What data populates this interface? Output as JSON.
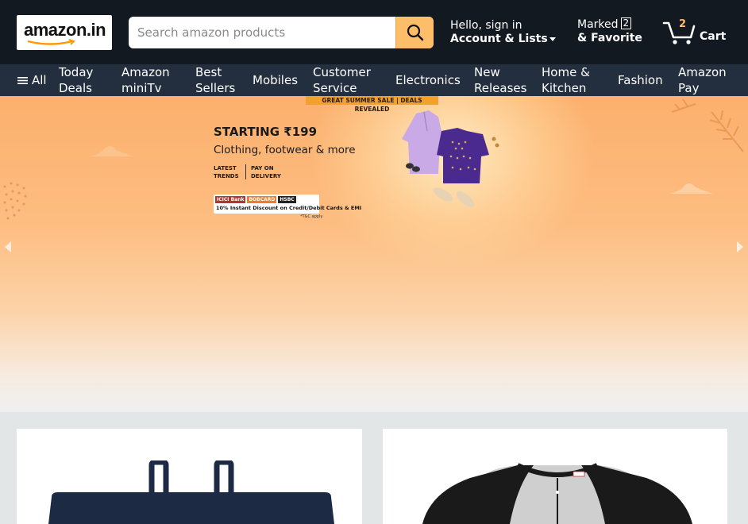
{
  "header": {
    "logo_text": "amazon.in",
    "search": {
      "placeholder": "Search amazon products"
    },
    "account": {
      "greeting": "Hello, sign in",
      "label": "Account & Lists"
    },
    "marked": {
      "label": "Marked",
      "count": "2",
      "sub": "& Favorite"
    },
    "cart": {
      "count": "2",
      "label": "Cart"
    }
  },
  "nav": {
    "all_label": "All",
    "items": [
      {
        "line1": "Today",
        "line2": "Deals"
      },
      {
        "line1": "Amazon",
        "line2": "miniTv"
      },
      {
        "line1": "Best",
        "line2": "Sellers"
      },
      {
        "line1": "Mobiles",
        "line2": ""
      },
      {
        "line1": "Customer",
        "line2": "Service"
      },
      {
        "line1": "Electronics",
        "line2": ""
      },
      {
        "line1": "New",
        "line2": "Releases"
      },
      {
        "line1": "Home &",
        "line2": "Kitchen"
      },
      {
        "line1": "Fashion",
        "line2": ""
      },
      {
        "line1": "Amazon",
        "line2": "Pay"
      }
    ]
  },
  "hero": {
    "sale_tag": "GREAT SUMMER SALE | DEALS REVEALED",
    "title": "STARTING ₹199",
    "subtitle": "Clothing, footwear & more",
    "tag_left": "LATEST TRENDS",
    "tag_right": "PAY ON DELIVERY",
    "bank_names": [
      "ICICI Bank",
      "BOBCARD",
      "HSBC"
    ],
    "bank_offer": "10% Instant Discount on Credit/Debit Cards & EMI",
    "tnc": "*T&C apply"
  },
  "colors": {
    "header_bg": "#131921",
    "nav_bg": "#232f3e",
    "accent": "#febd69",
    "hero_orange": "#fcb06d"
  }
}
